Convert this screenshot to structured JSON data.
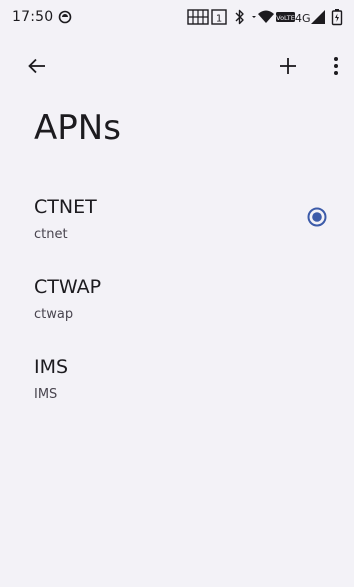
{
  "status_bar": {
    "time": "17:50",
    "network_label": "4G"
  },
  "app_bar": {
    "back_icon": "arrow-back-icon",
    "add_icon": "add-icon",
    "more_icon": "more-vert-icon"
  },
  "page": {
    "title": "APNs"
  },
  "apns": [
    {
      "name": "CTNET",
      "value": "ctnet",
      "selected": true
    },
    {
      "name": "CTWAP",
      "value": "ctwap",
      "selected": false
    },
    {
      "name": "IMS",
      "value": "IMS",
      "selected": false
    }
  ],
  "colors": {
    "background": "#f3f2f7",
    "accent": "#3c5ba9",
    "text_primary": "#1c1b1f",
    "text_secondary": "#49454f"
  }
}
